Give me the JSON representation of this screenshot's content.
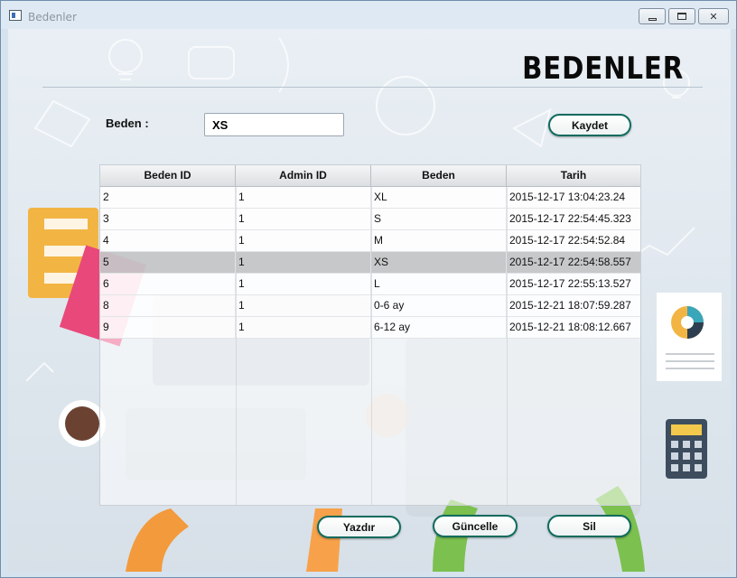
{
  "window": {
    "title": "Bedenler"
  },
  "page": {
    "title": "BEDENLER"
  },
  "form": {
    "beden_label": "Beden  :",
    "beden_value": "XS"
  },
  "buttons": {
    "kaydet": "Kaydet",
    "yazdir": "Yazdır",
    "guncelle": "Güncelle",
    "sil": "Sil"
  },
  "table": {
    "columns": [
      "Beden ID",
      "Admin ID",
      "Beden",
      "Tarih"
    ],
    "rows": [
      [
        "2",
        "1",
        "XL",
        "2015-12-17 13:04:23.24"
      ],
      [
        "3",
        "1",
        "S",
        "2015-12-17 22:54:45.323"
      ],
      [
        "4",
        "1",
        "M",
        "2015-12-17 22:54:52.84"
      ],
      [
        "5",
        "1",
        "XS",
        "2015-12-17 22:54:58.557"
      ],
      [
        "6",
        "1",
        "L",
        "2015-12-17 22:55:13.527"
      ],
      [
        "8",
        "1",
        "0-6 ay",
        "2015-12-21 18:07:59.287"
      ],
      [
        "9",
        "1",
        "6-12 ay",
        "2015-12-21 18:08:12.667"
      ]
    ],
    "selected_row": 3
  },
  "colors": {
    "button_border": "#0f6b5e",
    "selected_row": "#bec0c2"
  }
}
